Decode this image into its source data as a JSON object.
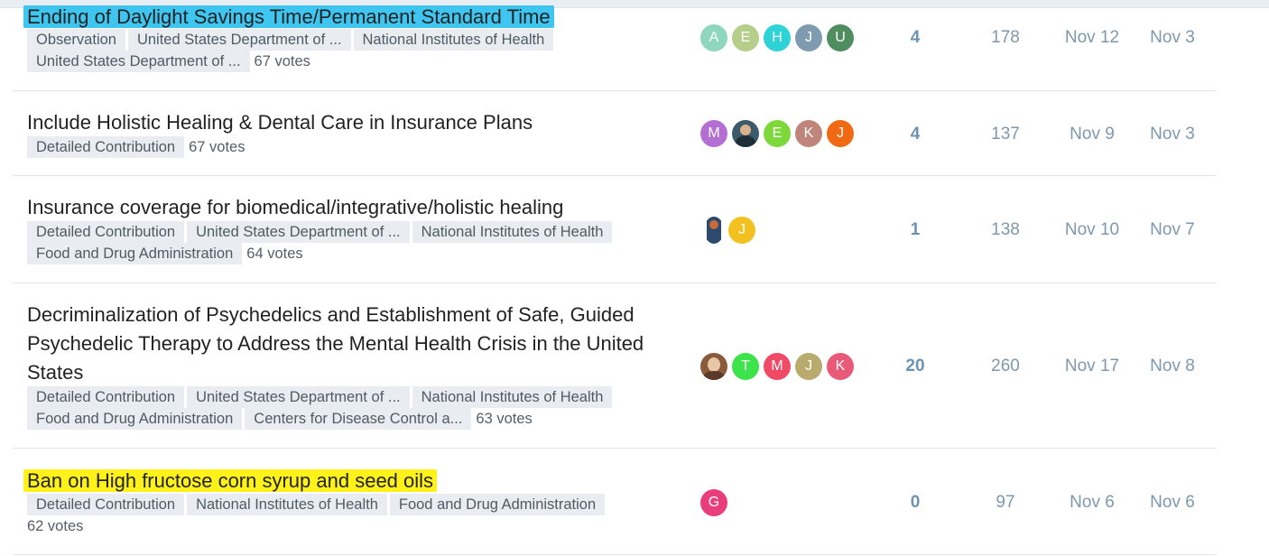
{
  "topics": [
    {
      "title": "Ending of Daylight Savings Time/Permanent Standard Time",
      "highlight": "#3ec6f0",
      "tags": [
        "Observation",
        "United States Department of ...",
        "National Institutes of Health",
        "United States Department of ..."
      ],
      "votes": "67 votes",
      "avatars": [
        {
          "letter": "A",
          "color": "#8fd6be"
        },
        {
          "letter": "E",
          "color": "#b5cf8a"
        },
        {
          "letter": "H",
          "color": "#2ed3d8"
        },
        {
          "letter": "J",
          "color": "#7f9bb0"
        },
        {
          "letter": "U",
          "color": "#4f8d5f"
        }
      ],
      "replies": "4",
      "views": "178",
      "activity": "Nov 12",
      "created": "Nov 3"
    },
    {
      "title": "Include Holistic Healing & Dental Care in Insurance Plans",
      "highlight": "",
      "tags": [
        "Detailed Contribution"
      ],
      "votes": "67 votes",
      "avatars": [
        {
          "letter": "M",
          "color": "#b46fd5"
        },
        {
          "letter": "",
          "color": "#3d5a6a",
          "photo": "profile-photo"
        },
        {
          "letter": "E",
          "color": "#7dd83c"
        },
        {
          "letter": "K",
          "color": "#c0857a"
        },
        {
          "letter": "J",
          "color": "#ef6a13"
        }
      ],
      "replies": "4",
      "views": "137",
      "activity": "Nov 9",
      "created": "Nov 3"
    },
    {
      "title": "Insurance coverage for biomedical/integrative/holistic healing",
      "highlight": "",
      "tags": [
        "Detailed Contribution",
        "United States Department of ...",
        "National Institutes of Health",
        "Food and Drug Administration"
      ],
      "votes": "64 votes",
      "avatars": [
        {
          "letter": "",
          "color": "#2c4a6e",
          "photo": "profile-photo"
        },
        {
          "letter": "J",
          "color": "#f2c11f"
        }
      ],
      "replies": "1",
      "views": "138",
      "activity": "Nov 10",
      "created": "Nov 7"
    },
    {
      "title": "Decriminalization of Psychedelics and Establishment of Safe, Guided Psychedelic Therapy to Address the Mental Health Crisis in the United States",
      "highlight": "",
      "tags": [
        "Detailed Contribution",
        "United States Department of ...",
        "National Institutes of Health",
        "Food and Drug Administration",
        "Centers for Disease Control a..."
      ],
      "votes": "63 votes",
      "avatars": [
        {
          "letter": "",
          "color": "#8a5a3c",
          "photo": "profile-photo"
        },
        {
          "letter": "T",
          "color": "#3de34a"
        },
        {
          "letter": "M",
          "color": "#ef4a66"
        },
        {
          "letter": "J",
          "color": "#b9aa6e"
        },
        {
          "letter": "K",
          "color": "#e95a78"
        }
      ],
      "replies": "20",
      "views": "260",
      "activity": "Nov 17",
      "created": "Nov 8"
    },
    {
      "title": "Ban on High fructose corn syrup and seed oils",
      "highlight": "#fff21a",
      "tags": [
        "Detailed Contribution",
        "National Institutes of Health",
        "Food and Drug Administration"
      ],
      "votes": "62 votes",
      "avatars": [
        {
          "letter": "G",
          "color": "#ea3e7c"
        }
      ],
      "replies": "0",
      "views": "97",
      "activity": "Nov 6",
      "created": "Nov 6"
    }
  ]
}
